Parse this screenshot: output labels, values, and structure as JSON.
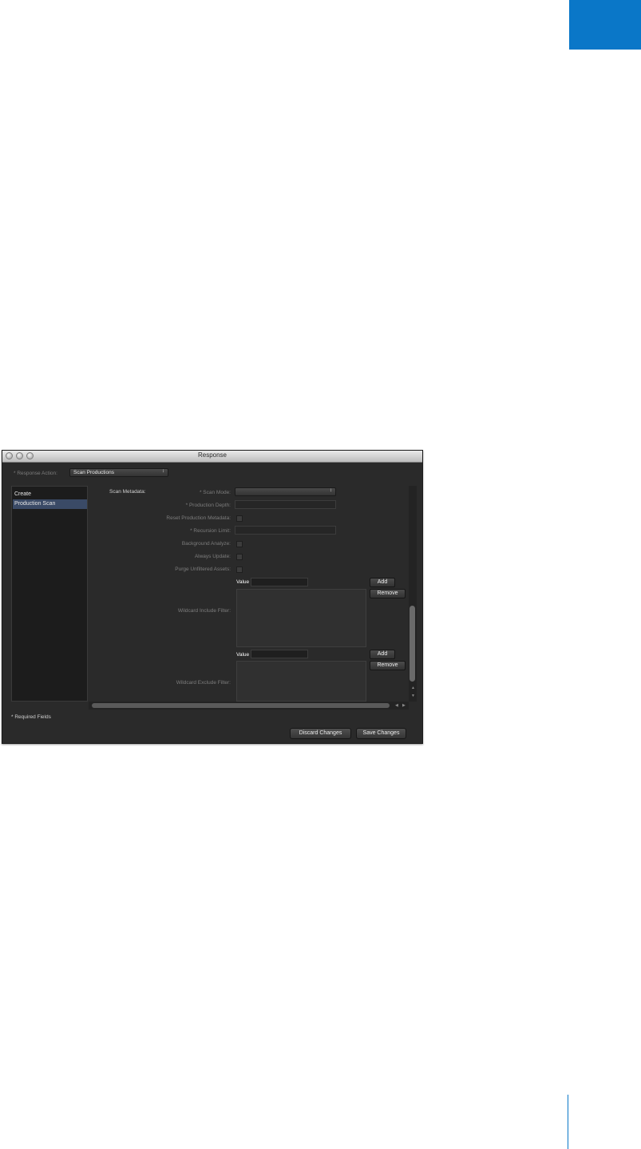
{
  "page": {
    "corner_tab_color": "#0a77c8"
  },
  "window": {
    "title": "Response",
    "response_action": {
      "label": "* Response Action:",
      "selected": "Scan Productions"
    },
    "sidebar": {
      "items": [
        {
          "label": "Create",
          "selected": false
        },
        {
          "label": "Production Scan",
          "selected": true
        }
      ]
    },
    "form": {
      "section_label": "Scan Metadata:",
      "scan_mode_label": "* Scan Mode:",
      "production_depth_label": "* Production Depth:",
      "reset_metadata_label": "Reset Production Metadata:",
      "recursion_limit_label": "* Recursion Limit:",
      "background_analyze_label": "Background Analyze:",
      "always_update_label": "Always Update:",
      "purge_assets_label": "Purge Unfiltered Assets:",
      "include_filter": {
        "label": "Wildcard Include Filter:",
        "value_label": "Value",
        "add": "Add",
        "remove": "Remove"
      },
      "exclude_filter": {
        "label": "Wildcard Exclude Filter:",
        "value_label": "Value",
        "add": "Add",
        "remove": "Remove"
      }
    },
    "footer": {
      "required_note": "* Required Fields",
      "discard": "Discard Changes",
      "save": "Save Changes"
    }
  }
}
